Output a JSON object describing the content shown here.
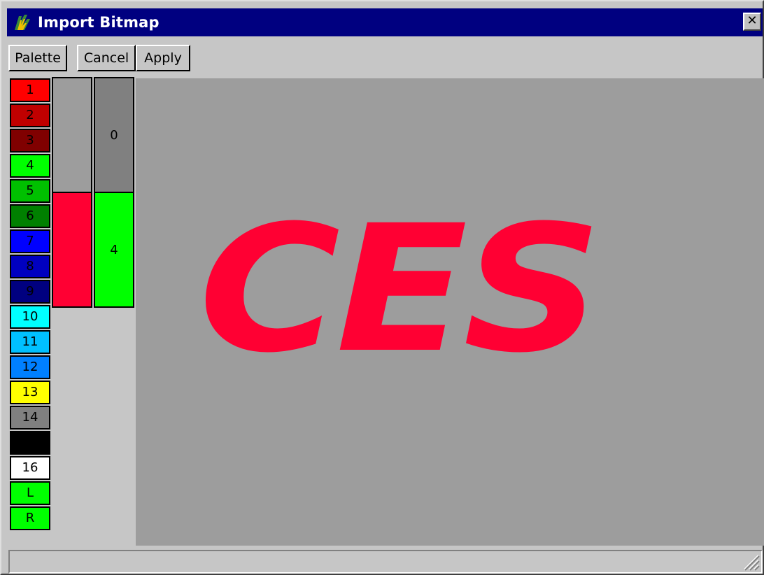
{
  "window": {
    "title": "Import Bitmap",
    "close_glyph": "✕",
    "icon": "app-icon"
  },
  "toolbar": {
    "palette_label": "Palette",
    "cancel_label": "Cancel",
    "apply_label": "Apply"
  },
  "palette": [
    {
      "label": "1",
      "color": "#ff0000",
      "text_color": "#000000"
    },
    {
      "label": "2",
      "color": "#c00000",
      "text_color": "#000000"
    },
    {
      "label": "3",
      "color": "#800000",
      "text_color": "#000000"
    },
    {
      "label": "4",
      "color": "#00ff00",
      "text_color": "#000000"
    },
    {
      "label": "5",
      "color": "#00c000",
      "text_color": "#000000"
    },
    {
      "label": "6",
      "color": "#008000",
      "text_color": "#000000"
    },
    {
      "label": "7",
      "color": "#0000ff",
      "text_color": "#000000"
    },
    {
      "label": "8",
      "color": "#0000c0",
      "text_color": "#000000"
    },
    {
      "label": "9",
      "color": "#000080",
      "text_color": "#000000"
    },
    {
      "label": "10",
      "color": "#00ffff",
      "text_color": "#000000"
    },
    {
      "label": "11",
      "color": "#00c0ff",
      "text_color": "#000000"
    },
    {
      "label": "12",
      "color": "#0080ff",
      "text_color": "#000000"
    },
    {
      "label": "13",
      "color": "#ffff00",
      "text_color": "#000000"
    },
    {
      "label": "14",
      "color": "#808080",
      "text_color": "#000000"
    },
    {
      "label": "",
      "color": "#000000",
      "text_color": "#000000"
    },
    {
      "label": "16",
      "color": "#ffffff",
      "text_color": "#000000"
    },
    {
      "label": "L",
      "color": "#00ff00",
      "text_color": "#000000"
    },
    {
      "label": "R",
      "color": "#00ff00",
      "text_color": "#000000"
    }
  ],
  "mapping": {
    "source_top_color": "#9d9d9d",
    "source_bottom_color": "#ff0033",
    "target_top_label": "0",
    "target_top_color": "#808080",
    "target_bottom_label": "4",
    "target_bottom_color": "#00ff00"
  },
  "canvas": {
    "background": "#9d9d9d",
    "text": "CES",
    "text_color": "#ff0033"
  }
}
